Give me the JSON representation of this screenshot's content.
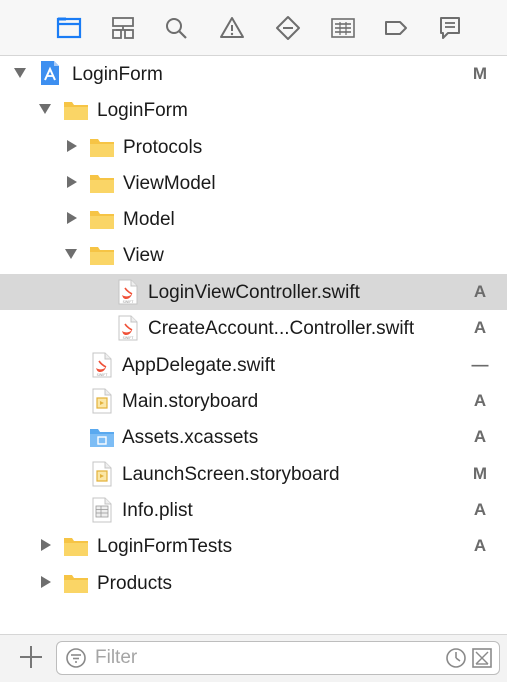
{
  "toolbar": {
    "buttons": [
      {
        "name": "project-navigator-icon",
        "selected": true
      },
      {
        "name": "symbol-navigator-icon"
      },
      {
        "name": "find-navigator-icon"
      },
      {
        "name": "issue-navigator-icon"
      },
      {
        "name": "test-navigator-icon"
      },
      {
        "name": "debug-navigator-icon"
      },
      {
        "name": "breakpoint-navigator-icon"
      },
      {
        "name": "report-navigator-icon"
      }
    ],
    "accent_color": "#1a7cf5",
    "icon_color": "#6e6e6e"
  },
  "tree": {
    "items": [
      {
        "label": "LoginForm",
        "status": "M",
        "icon": "project-icon",
        "disclosure": "open"
      },
      {
        "label": "LoginForm",
        "status": "",
        "icon": "folder-icon",
        "disclosure": "open"
      },
      {
        "label": "Protocols",
        "status": "",
        "icon": "folder-icon",
        "disclosure": "closed"
      },
      {
        "label": "ViewModel",
        "status": "",
        "icon": "folder-icon",
        "disclosure": "closed"
      },
      {
        "label": "Model",
        "status": "",
        "icon": "folder-icon",
        "disclosure": "closed"
      },
      {
        "label": "View",
        "status": "",
        "icon": "folder-icon",
        "disclosure": "open"
      },
      {
        "label": "LoginViewController.swift",
        "status": "A",
        "icon": "swift-file-icon",
        "selected": true
      },
      {
        "label": "CreateAccount...Controller.swift",
        "status": "A",
        "icon": "swift-file-icon"
      },
      {
        "label": "AppDelegate.swift",
        "status": "—",
        "icon": "swift-file-icon"
      },
      {
        "label": "Main.storyboard",
        "status": "A",
        "icon": "storyboard-file-icon"
      },
      {
        "label": "Assets.xcassets",
        "status": "A",
        "icon": "asset-catalog-icon"
      },
      {
        "label": "LaunchScreen.storyboard",
        "status": "M",
        "icon": "storyboard-file-icon"
      },
      {
        "label": "Info.plist",
        "status": "A",
        "icon": "plist-file-icon"
      },
      {
        "label": "LoginFormTests",
        "status": "A",
        "icon": "folder-icon",
        "disclosure": "closed"
      },
      {
        "label": "Products",
        "status": "",
        "icon": "folder-icon",
        "disclosure": "closed"
      }
    ]
  },
  "bottom": {
    "add_icon": "plus-icon",
    "filter_placeholder": "Filter",
    "filter_value": "",
    "filter_icon": "filter-icon",
    "recent_icon": "clock-icon",
    "scm_icon": "source-control-filter-icon"
  },
  "colors": {
    "folder": "#f6c445",
    "folder_dark": "#e6ac2a",
    "selection": "#d8d8d8",
    "swift": "#f05138",
    "status_text": "#6b6b6b"
  }
}
